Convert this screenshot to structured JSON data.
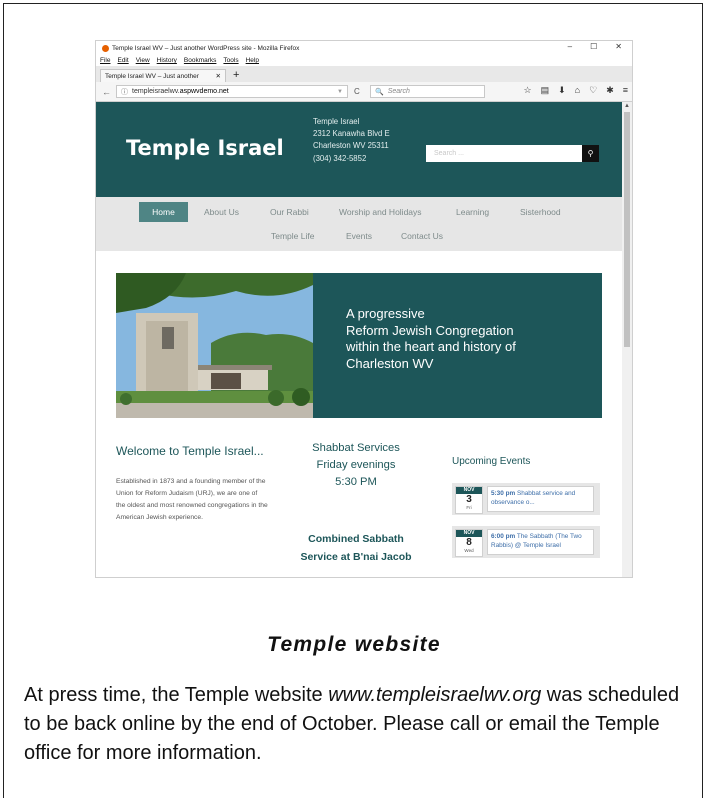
{
  "browser": {
    "window_title": "Temple Israel WV – Just another WordPress site - Mozilla Firefox",
    "menu": [
      "File",
      "Edit",
      "View",
      "History",
      "Bookmarks",
      "Tools",
      "Help"
    ],
    "tab_title": "Temple Israel WV – Just another",
    "url_prefix": "templeisraelwv.",
    "url_domain": "aspwvdemo.net",
    "search_placeholder": "Search"
  },
  "site": {
    "logo": "Temple Israel",
    "address": [
      "Temple Israel",
      "2312 Kanawha Blvd E",
      "Charleston WV 25311",
      "(304) 342-5852"
    ],
    "search_placeholder": "Search ...",
    "nav_row1": [
      "Home",
      "About Us",
      "Our Rabbi",
      "Worship and Holidays",
      "Learning",
      "Sisterhood"
    ],
    "nav_row2": [
      "Temple Life",
      "Events",
      "Contact Us"
    ],
    "hero_lines": [
      "A progressive",
      "Reform Jewish Congregation",
      "within the heart and history of",
      "Charleston WV"
    ],
    "welcome_title": "Welcome to Temple Israel...",
    "welcome_text": "Established in 1873 and a founding member of the Union for Reform Judaism (URJ), we are one of the oldest and most renowned congregations in the American Jewish experience.",
    "services_lines": [
      "Shabbat Services",
      "Friday evenings",
      "5:30 PM"
    ],
    "combined_lines": [
      "Combined Sabbath",
      "Service at B'nai Jacob"
    ],
    "upcoming_title": "Upcoming Events",
    "events": [
      {
        "month": "NOV",
        "day": "3",
        "dow": "Fri",
        "time": "5:30 pm",
        "title": "Shabbat service and observance o..."
      },
      {
        "month": "NOV",
        "day": "8",
        "dow": "Wed",
        "time": "6:00 pm",
        "title": "The Sabbath (The Two Rabbis) @ Temple Israel"
      }
    ]
  },
  "article": {
    "caption": "Temple website",
    "text_before": "At press time, the Temple website ",
    "url_italic": "www.templeisraelwv.org",
    "text_after": " was scheduled to be back online by the end of October. Please call or email the Temple office for more information."
  }
}
